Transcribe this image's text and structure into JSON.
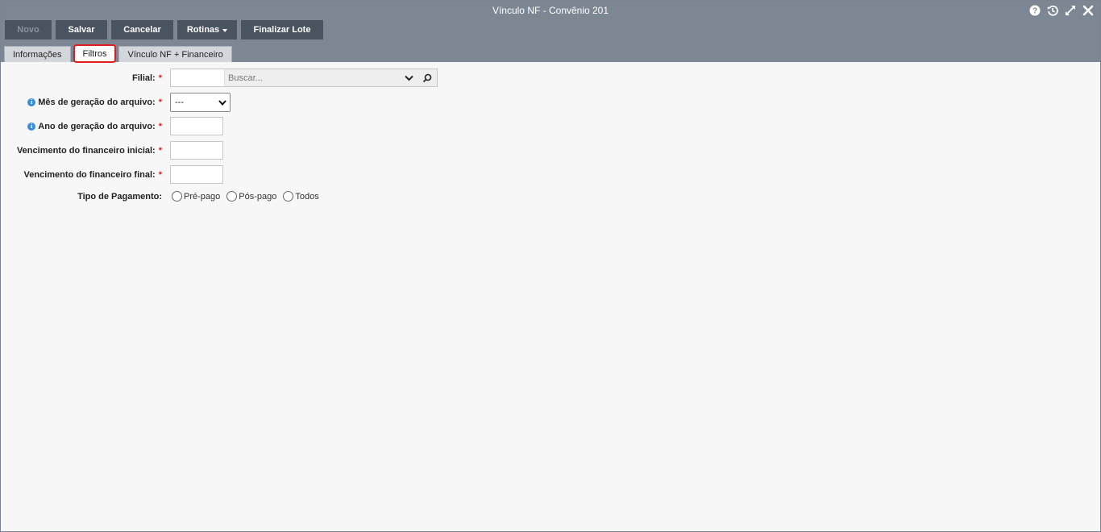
{
  "window": {
    "title": "Vínculo NF - Convênio 201"
  },
  "toolbar": {
    "novo": "Novo",
    "salvar": "Salvar",
    "cancelar": "Cancelar",
    "rotinas": "Rotinas",
    "finalizar_lote": "Finalizar Lote"
  },
  "tabs": [
    {
      "label": "Informações"
    },
    {
      "label": "Filtros"
    },
    {
      "label": "Vínculo NF + Financeiro"
    }
  ],
  "form": {
    "filial": {
      "label": "Filial:",
      "placeholder": "Buscar..."
    },
    "mes": {
      "label": "Mês de geração do arquivo:",
      "value": "---"
    },
    "ano": {
      "label": "Ano de geração do arquivo:"
    },
    "venc_inicial": {
      "label": "Vencimento do financeiro inicial:"
    },
    "venc_final": {
      "label": "Vencimento do financeiro final:"
    },
    "tipo_pagamento": {
      "label": "Tipo de Pagamento:",
      "options": [
        "Pré-pago",
        "Pós-pago",
        "Todos"
      ]
    },
    "required_mark": "*",
    "info_mark": "i"
  }
}
